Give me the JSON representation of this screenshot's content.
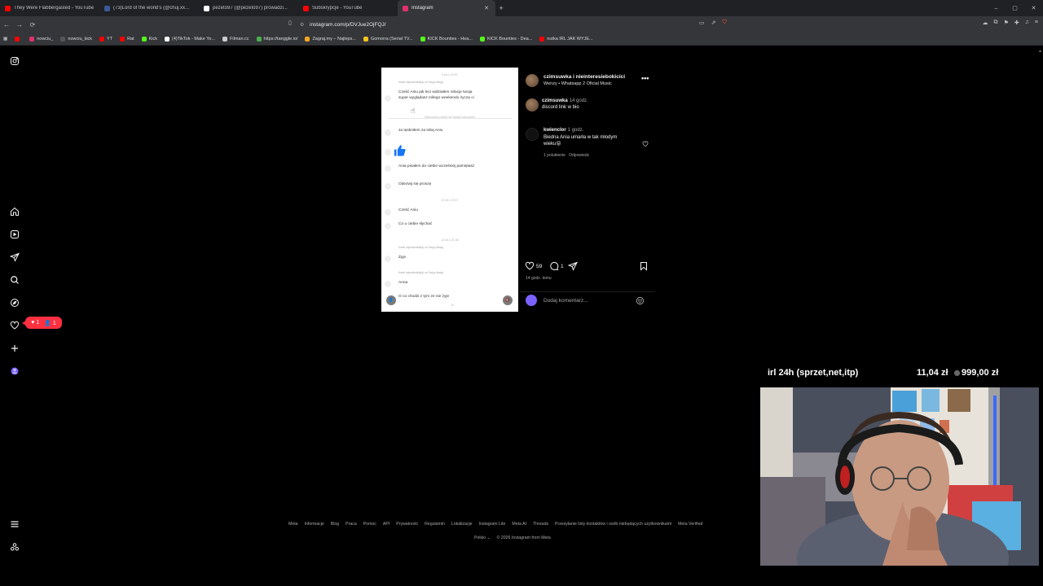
{
  "browser": {
    "tabs": [
      {
        "label": "They Were Flabbergasted - YouTube",
        "favicon_color": "#ff0000"
      },
      {
        "label": "(73)Lord of the world's (@chuj.xx...",
        "favicon_color": "#3b5998"
      },
      {
        "label": "pezeto97 (@pezeto97) prowadzi...",
        "favicon_color": "#ffffff"
      },
      {
        "label": "Subskrypcje - YouTube",
        "favicon_color": "#ff0000"
      },
      {
        "label": "Instagram",
        "favicon_color": "#e1306c",
        "active": true
      }
    ],
    "new_tab_glyph": "+",
    "window_controls": [
      "–",
      "▢",
      "✕"
    ],
    "url": "instagram.com/p/DVJue2OjFQJ/",
    "bookmarks": [
      {
        "label": "",
        "color": "#ff0000"
      },
      {
        "label": "nowciu_",
        "color": "#e1306c"
      },
      {
        "label": "nowciu_kick",
        "color": "#000000"
      },
      {
        "label": "YT",
        "color": "#ff0000"
      },
      {
        "label": "Rat",
        "color": "#ff0000"
      },
      {
        "label": "Kick",
        "color": "#53fc18"
      },
      {
        "label": "(4)TikTok - Make Yo...",
        "color": "#ffffff"
      },
      {
        "label": "Filman.cc",
        "color": "#cccccc"
      },
      {
        "label": "https://tanggle.io/",
        "color": "#4caf50"
      },
      {
        "label": "Zagraj.my – Najleps...",
        "color": "#f5a623"
      },
      {
        "label": "Gomorra (Serial TV...",
        "color": "#f5c518"
      },
      {
        "label": "KICK Bounties - Hea...",
        "color": "#53fc18"
      },
      {
        "label": "KICK Bounties - Dea...",
        "color": "#53fc18"
      },
      {
        "label": "nutka IRL JAK WYJE...",
        "color": "#ff0000"
      }
    ]
  },
  "notifications": {
    "likes": "1",
    "follows": "1"
  },
  "post_media": {
    "time1": "6 lut o 20:37",
    "reply1": "Kamil odpowiedział(a) na Twoją relację",
    "msg1a": "Cześć Aniu jak leci widziałem relacje twoja",
    "msg1b": "super wyglądasz miłego weekendu życzę ci",
    "divider": "Wiadomości poniżej nie zostały przeczytane",
    "msg2": "Ja tęskniłem za tobą Aniu",
    "msg3": "Ania pisałem do ciebie wcześniej pamiętasz",
    "msg4": "Odezwij się proszę",
    "time2": "13 lut o 22:17",
    "msg5": "Cześć Aniu",
    "msg6": "Co u ciebie słychać",
    "time3": "14 lut o 21:38",
    "reply2": "Kamil odpowiedział(a) na Twoją relację",
    "msg7": "Żyje",
    "reply3": "Kamil odpowiedział(a) na Twoją relację",
    "msg8": "Anna",
    "msg9": "O co chodzi z tym ze nie żyje",
    "user_tag_glyph": "👤",
    "audio_glyph": "🔇"
  },
  "post_panel": {
    "author": "czimsuwka i nieinteresiebokicici",
    "audio": "Wenzy • Whatsapp 2 Oficial Music",
    "more": "•••",
    "caption_user": "czimsuwka",
    "caption_time": "14 godz.",
    "caption_text": "discord link w bio",
    "comment_user": "kwienclor",
    "comment_time": "1 godz.",
    "comment_text1": "Biedna Ania umarła w tak młodym",
    "comment_text2": "wieku😝",
    "comment_likes": "1 polubienie",
    "comment_reply": "Odpowiedz",
    "like_count": "59",
    "comment_count": "1",
    "post_age": "14 godz. temu",
    "add_comment_placeholder": "Dodaj komentarz..."
  },
  "footer": {
    "links": [
      "Meta",
      "Informacje",
      "Blog",
      "Praca",
      "Pomoc",
      "API",
      "Prywatność",
      "Regulamin",
      "Lokalizacje",
      "Instagram Lite",
      "Meta AI",
      "Threads",
      "Przesyłanie listy kontaktów i osób niebędących użytkownikami",
      "Meta Verified"
    ],
    "language": "Polski ⌄",
    "copyright": "© 2026 Instagram from Meta"
  },
  "overlay": {
    "goal_label": "irl 24h (sprzet,net,itp)",
    "goal_amount": "11,04 zł",
    "goal_target": "999,00 zł"
  },
  "colors": {
    "accent_red": "#ff3040",
    "ig_text": "#f5f5f5",
    "ig_muted": "#a8a8a8",
    "like_blue": "#1877f2"
  }
}
